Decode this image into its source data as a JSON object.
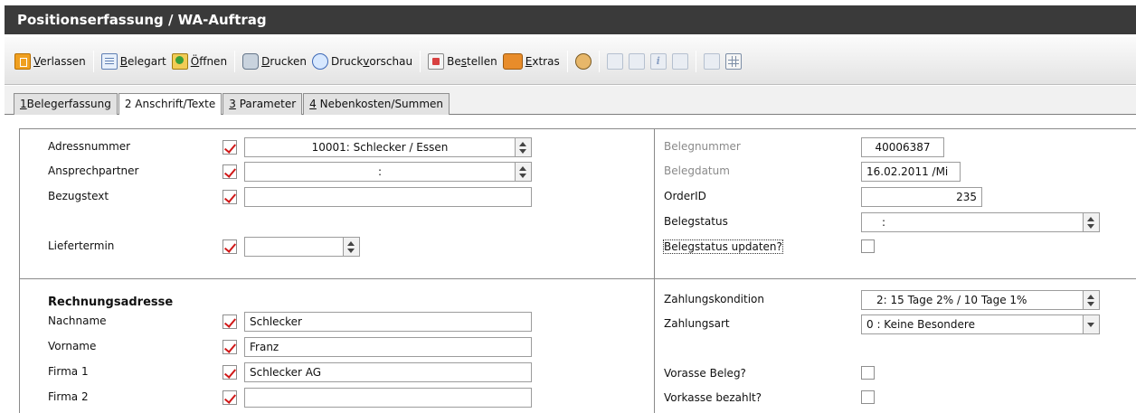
{
  "window": {
    "title": "Positionserfassung / WA-Auftrag"
  },
  "toolbar": {
    "verlassen": {
      "pre": "",
      "key": "V",
      "post": "erlassen"
    },
    "belegart": {
      "pre": "",
      "key": "B",
      "post": "elegart"
    },
    "oeffnen": {
      "pre": "",
      "key": "Ö",
      "post": "ffnen"
    },
    "drucken": {
      "pre": "",
      "key": "D",
      "post": "rucken"
    },
    "druckvorschau": {
      "pre": "Druck",
      "key": "v",
      "post": "orschau"
    },
    "bestellen": {
      "pre": "Be",
      "key": "s",
      "post": "tellen"
    },
    "extras": {
      "pre": "",
      "key": "E",
      "post": "xtras"
    }
  },
  "tabs": [
    {
      "num": "1",
      "label": "Belegerfassung",
      "active": false
    },
    {
      "num": "2",
      "label": "Anschrift/Texte",
      "active": true
    },
    {
      "num": "3",
      "label": "Parameter",
      "active": false
    },
    {
      "num": "4",
      "label": "Nebenkosten/Summen",
      "active": false
    }
  ],
  "left_top": {
    "adressnummer": {
      "label": "Adressnummer",
      "value": "10001: Schlecker / Essen"
    },
    "ansprechpartner": {
      "label": "Ansprechpartner",
      "value": ":"
    },
    "bezugstext": {
      "label": "Bezugstext",
      "value": ""
    },
    "liefertermin": {
      "label": "Liefertermin",
      "value": ""
    }
  },
  "right_top": {
    "belegnummer": {
      "label": "Belegnummer",
      "value": "40006387"
    },
    "belegdatum": {
      "label": "Belegdatum",
      "value": "16.02.2011 /Mi"
    },
    "orderid": {
      "label": "OrderID",
      "value": "235"
    },
    "belegstatus": {
      "label": "Belegstatus",
      "value": ":"
    },
    "belegstatus_update": {
      "label": "Belegstatus updaten?"
    }
  },
  "rechnung": {
    "heading": "Rechnungsadresse",
    "nachname": {
      "label": "Nachname",
      "value": "Schlecker"
    },
    "vorname": {
      "label": "Vorname",
      "value": "Franz"
    },
    "firma1": {
      "label": "Firma 1",
      "value": "Schlecker AG"
    },
    "firma2": {
      "label": "Firma 2",
      "value": ""
    }
  },
  "zahlung": {
    "kondition": {
      "label": "Zahlungskondition",
      "value": "2: 15 Tage 2% / 10 Tage 1%"
    },
    "art": {
      "label": "Zahlungsart",
      "value": "0 : Keine Besondere"
    },
    "vorasse": {
      "label": "Vorasse Beleg?"
    },
    "vorkasse_bezahlt": {
      "label": "Vorkasse bezahlt?"
    }
  },
  "colors": {
    "titlebar": "#3a3a3a",
    "check": "#d01818"
  }
}
